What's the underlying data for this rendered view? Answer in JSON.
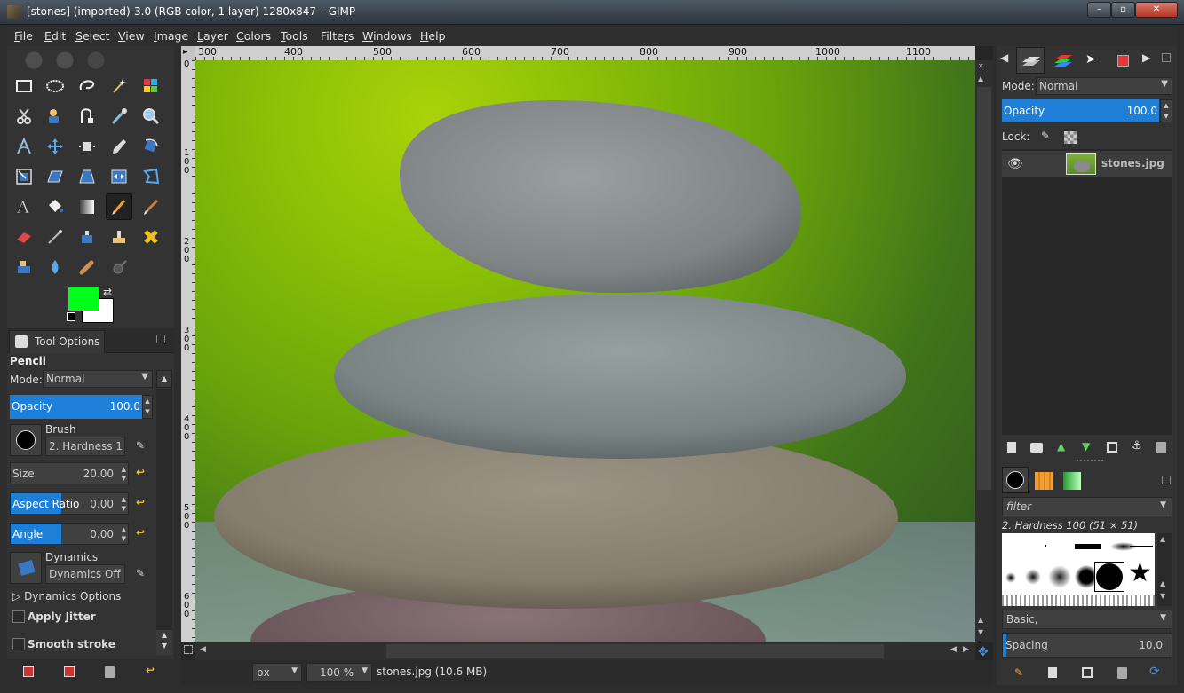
{
  "window": {
    "title": "[stones] (imported)-3.0 (RGB color, 1 layer) 1280x847 – GIMP",
    "buttons": [
      "–",
      "▫",
      "✕"
    ]
  },
  "menu": [
    {
      "pre": "",
      "u": "F",
      "post": "ile"
    },
    {
      "pre": "",
      "u": "E",
      "post": "dit"
    },
    {
      "pre": "",
      "u": "S",
      "post": "elect"
    },
    {
      "pre": "",
      "u": "V",
      "post": "iew"
    },
    {
      "pre": "",
      "u": "I",
      "post": "mage"
    },
    {
      "pre": "",
      "u": "L",
      "post": "ayer"
    },
    {
      "pre": "",
      "u": "C",
      "post": "olors"
    },
    {
      "pre": "",
      "u": "T",
      "post": "ools"
    },
    {
      "pre": "Filte",
      "u": "r",
      "post": "s"
    },
    {
      "pre": "",
      "u": "W",
      "post": "indows"
    },
    {
      "pre": "",
      "u": "H",
      "post": "elp"
    }
  ],
  "colors": {
    "accent": "#1e7fd8",
    "foreground": "#00ff19",
    "background": "#ffffff"
  },
  "tool_options": {
    "tab_label": "Tool Options",
    "tool_name": "Pencil",
    "mode_label": "Mode:",
    "mode_value": "Normal",
    "opacity_label": "Opacity",
    "opacity_value": "100.0",
    "brush_label": "Brush",
    "brush_value": "2. Hardness 1",
    "size_label": "Size",
    "size_value": "20.00",
    "aspect_label": "Aspect Ratio",
    "aspect_value": "0.00",
    "angle_label": "Angle",
    "angle_value": "0.00",
    "dynamics_label": "Dynamics",
    "dynamics_value": "Dynamics Off",
    "dynamics_options": "Dynamics Options",
    "apply_jitter": "Apply Jitter",
    "smooth_stroke": "Smooth stroke"
  },
  "rulers": {
    "top": [
      "300",
      "400",
      "500",
      "600",
      "700",
      "800",
      "900",
      "1000",
      "1100"
    ],
    "left": [
      "0",
      "1\n0\n0",
      "2\n0\n0",
      "3\n0\n0",
      "4\n0\n0",
      "5\n0\n0",
      "6\n0\n0"
    ]
  },
  "status": {
    "unit": "px",
    "zoom": "100 %",
    "file_info": "stones.jpg (10.6 MB)"
  },
  "layers": {
    "mode_label": "Mode:",
    "mode_value": "Normal",
    "opacity_label": "Opacity",
    "opacity_value": "100.0",
    "lock_label": "Lock:",
    "layer_name": "stones.jpg"
  },
  "brushes": {
    "filter_placeholder": "filter",
    "selected_brush": "2. Hardness 100 (51 × 51)",
    "preset": "Basic,",
    "spacing_label": "Spacing",
    "spacing_value": "10.0"
  }
}
